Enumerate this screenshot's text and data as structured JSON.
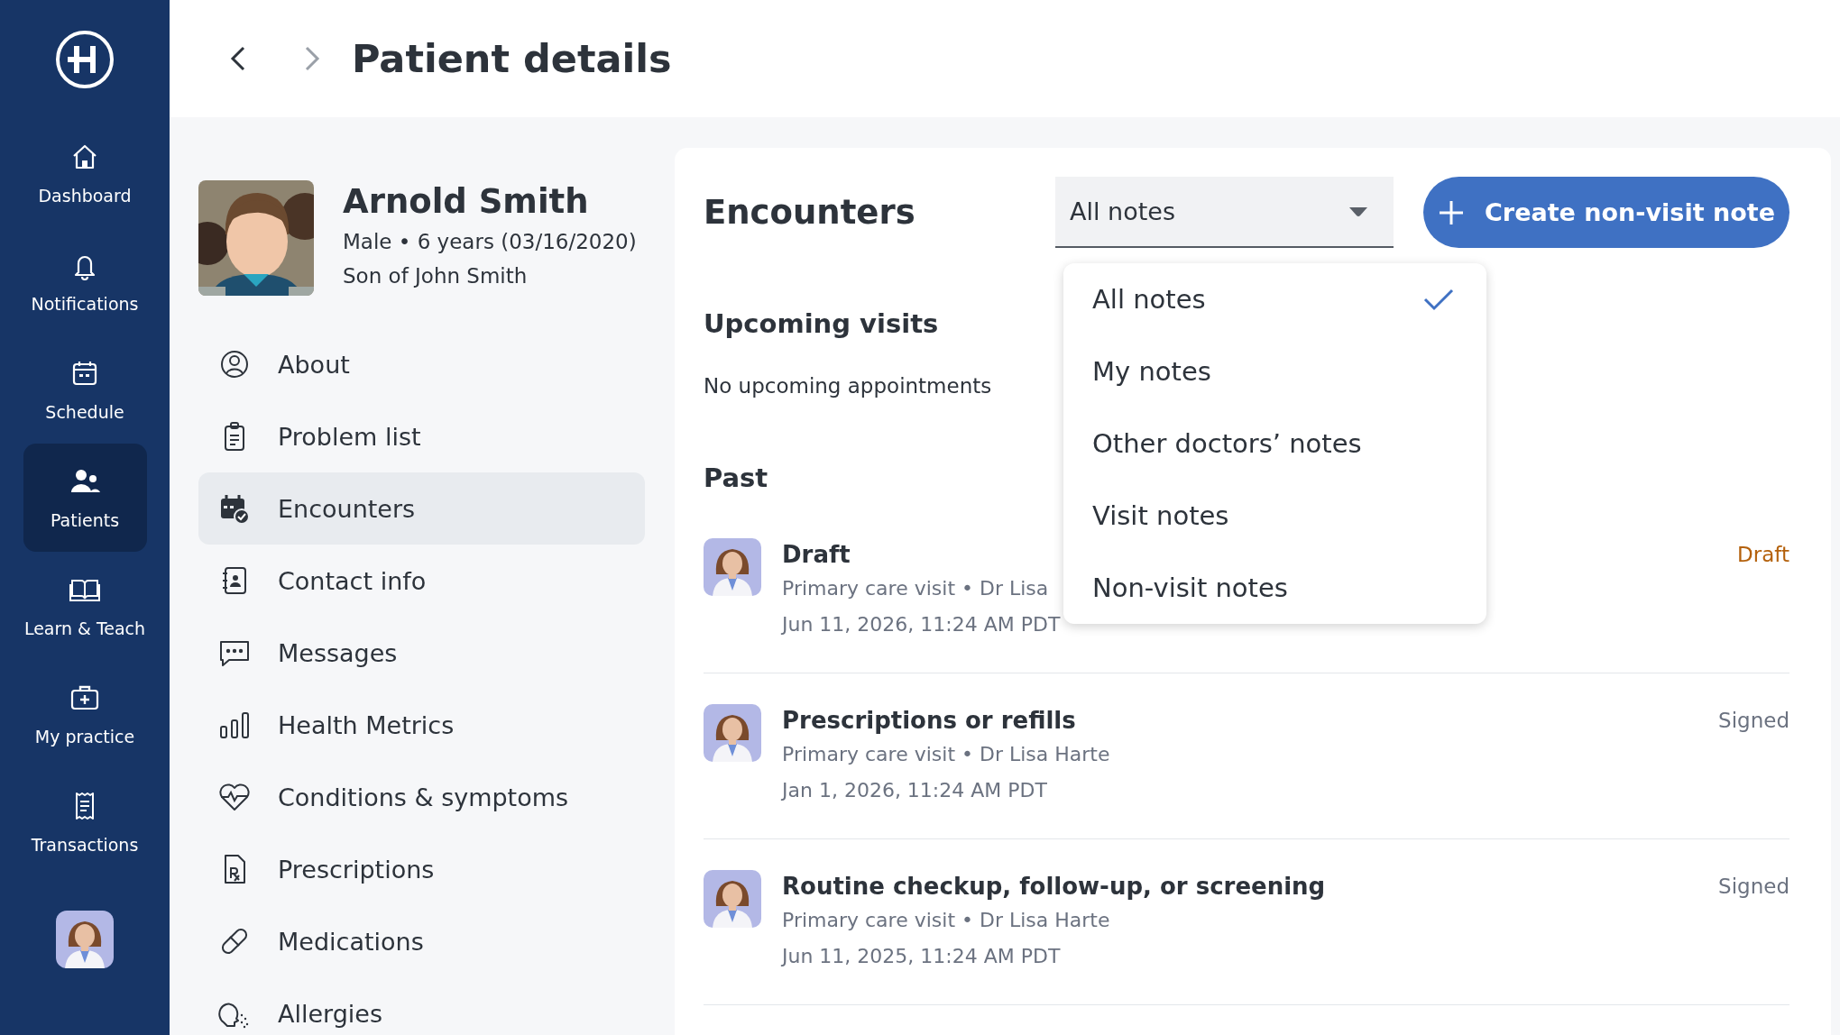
{
  "nav": {
    "items": [
      {
        "label": "Dashboard",
        "selected": false
      },
      {
        "label": "Notifications",
        "selected": false
      },
      {
        "label": "Schedule",
        "selected": false
      },
      {
        "label": "Patients",
        "selected": true
      },
      {
        "label": "Learn & Teach",
        "selected": false
      },
      {
        "label": "My practice",
        "selected": false
      },
      {
        "label": "Transactions",
        "selected": false
      }
    ]
  },
  "header": {
    "title": "Patient details"
  },
  "patient": {
    "name": "Arnold Smith",
    "details": "Male • 6 years (03/16/2020)",
    "relation": "Son of John Smith"
  },
  "menu": {
    "items": [
      {
        "label": "About",
        "selected": false
      },
      {
        "label": "Problem list",
        "selected": false
      },
      {
        "label": "Encounters",
        "selected": true
      },
      {
        "label": "Contact info",
        "selected": false
      },
      {
        "label": "Messages",
        "selected": false
      },
      {
        "label": "Health Metrics",
        "selected": false
      },
      {
        "label": "Conditions & symptoms",
        "selected": false
      },
      {
        "label": "Prescriptions",
        "selected": false
      },
      {
        "label": "Medications",
        "selected": false
      },
      {
        "label": "Allergies",
        "selected": false
      }
    ]
  },
  "encounters": {
    "title": "Encounters",
    "filter": {
      "value": "All notes"
    },
    "create_button": "Create non-visit note",
    "dropdown": {
      "options": [
        {
          "label": "All notes",
          "selected": true
        },
        {
          "label": "My notes",
          "selected": false
        },
        {
          "label": "Other doctors’ notes",
          "selected": false
        },
        {
          "label": "Visit notes",
          "selected": false
        },
        {
          "label": "Non-visit notes",
          "selected": false
        }
      ]
    },
    "upcoming": {
      "title": "Upcoming visits",
      "empty_text": "No upcoming appointments"
    },
    "past": {
      "title": "Past",
      "rows": [
        {
          "title": "Draft",
          "meta": "Primary care visit • Dr Lisa",
          "date": "Jun 11, 2026, 11:24 AM PDT",
          "status": "Draft",
          "kind": "draft"
        },
        {
          "title": "Prescriptions or refills",
          "meta": "Primary care visit • Dr Lisa Harte",
          "date": "Jan 1, 2026, 11:24 AM PDT",
          "status": "Signed",
          "kind": "signed"
        },
        {
          "title": "Routine checkup, follow-up, or screening",
          "meta": "Primary care visit • Dr Lisa Harte",
          "date": "Jun 11, 2025, 11:24 AM PDT",
          "status": "Signed",
          "kind": "signed"
        }
      ]
    }
  }
}
